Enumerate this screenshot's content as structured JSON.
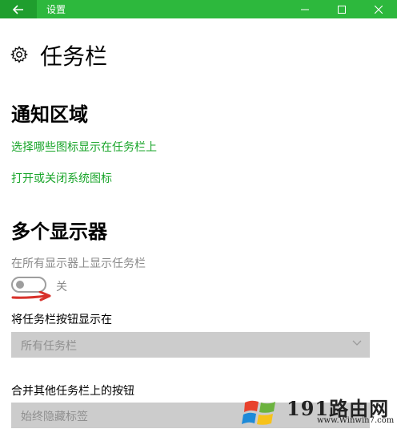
{
  "window": {
    "title": "设置",
    "back_icon": "back-arrow-icon",
    "minimize_icon": "minimize-icon",
    "maximize_icon": "maximize-icon",
    "close_icon": "close-icon",
    "accent": "#2db83d"
  },
  "page": {
    "title": "任务栏",
    "icon": "gear-icon"
  },
  "notification_area": {
    "heading": "通知区域",
    "link_icons": "选择哪些图标显示在任务栏上",
    "link_system_icons": "打开或关闭系统图标"
  },
  "multiple_displays": {
    "heading": "多个显示器",
    "show_all_label": "在所有显示器上显示任务栏",
    "toggle_state": "关",
    "buttons_label": "将任务栏按钮显示在",
    "buttons_value": "所有任务栏",
    "combine_label": "合并其他任务栏上的按钮",
    "combine_value": "始终隐藏标签"
  },
  "watermark": {
    "brand": "191路由网",
    "url": "www.Winwin7.com"
  }
}
